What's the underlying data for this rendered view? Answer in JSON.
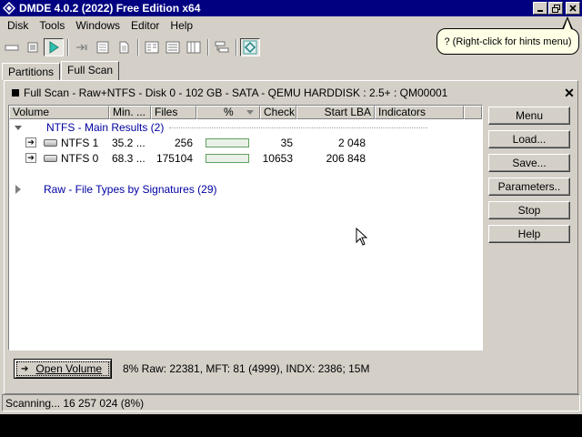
{
  "window": {
    "title": "DMDE 4.0.2 (2022) Free Edition x64",
    "icon": "dmde-app-icon",
    "controls": [
      "minimize",
      "maximize",
      "close"
    ]
  },
  "menu": [
    "Disk",
    "Tools",
    "Windows",
    "Editor",
    "Help"
  ],
  "toolbar": {
    "icons": [
      "partitions-icon",
      "list-icon",
      "play-icon",
      "go-to-icon",
      "sector-icon",
      "file-icon",
      "panel-icon-1",
      "panel-icon-2",
      "panel-icon-3",
      "tree-icon",
      "recovery-icon"
    ]
  },
  "hint": "? (Right-click for hints menu)",
  "tabs": [
    "Partitions",
    "Full Scan"
  ],
  "panel": {
    "title": "Full Scan - Raw+NTFS - Disk 0 - 102 GB - SATA - QEMU HARDDISK : 2.5+ : QM00001",
    "close": "✕"
  },
  "columns": [
    "Volume",
    "Min. ...",
    "Files",
    "%",
    "Check",
    "Start LBA",
    "Indicators"
  ],
  "groups": {
    "ntfs": "NTFS - Main Results (2)",
    "raw": "Raw - File Types by Signatures (29)"
  },
  "rows": [
    {
      "volume": "NTFS 1",
      "min": "35.2 ...",
      "files": "256",
      "percent": 0.96,
      "check": "35",
      "start_lba": "2 048"
    },
    {
      "volume": "NTFS 0",
      "min": "68.3 ...",
      "files": "175104",
      "percent": 0.1,
      "check": "10653",
      "start_lba": "206 848"
    }
  ],
  "buttons": [
    "Menu",
    "Load...",
    "Save...",
    "Parameters..",
    "Stop",
    "Help"
  ],
  "open_volume": "Open Volume",
  "scan_stats": "8% Raw: 22381, MFT: 81 (4999), INDX: 2386; 15M",
  "status": "Scanning... 16 257 024 (8%)",
  "colors": {
    "title_bar": "#000080",
    "group_text": "#0000a0",
    "progress": "#30b040"
  }
}
